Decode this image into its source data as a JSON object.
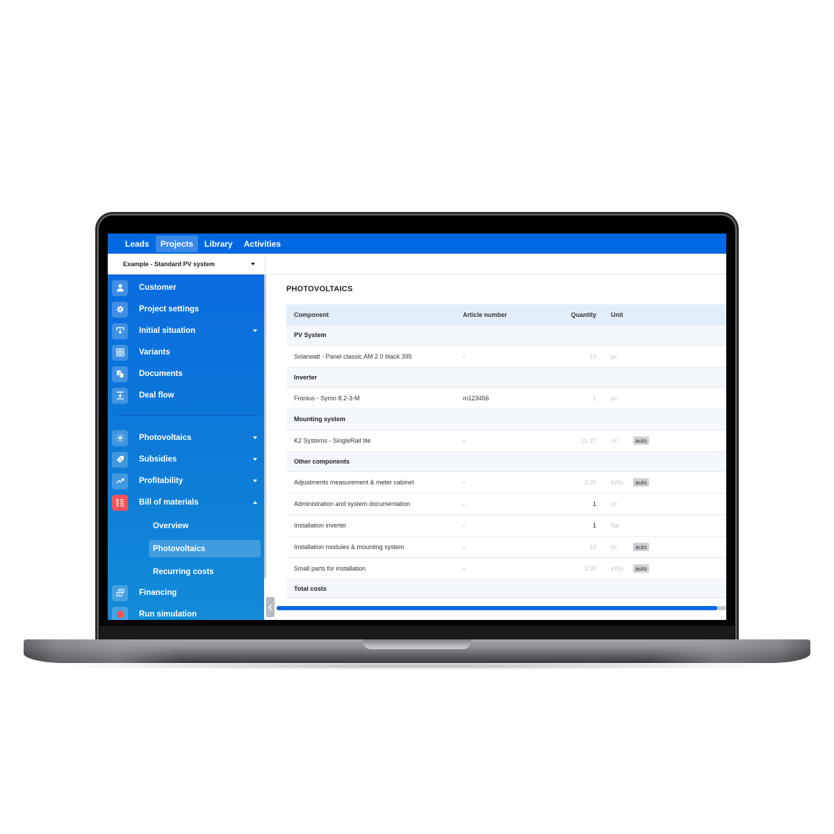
{
  "nav": {
    "tabs": [
      {
        "label": "Leads",
        "active": false
      },
      {
        "label": "Projects",
        "active": true
      },
      {
        "label": "Library",
        "active": false
      },
      {
        "label": "Activities",
        "active": false
      }
    ],
    "brand_color": "#0068e0"
  },
  "project_selector": {
    "value": "Example - Standard PV system"
  },
  "sidebar": {
    "items": [
      {
        "label": "Customer",
        "icon": "user-icon",
        "expandable": false
      },
      {
        "label": "Project settings",
        "icon": "gear-icon",
        "expandable": false
      },
      {
        "label": "Initial situation",
        "icon": "download-tray-icon",
        "expandable": true
      },
      {
        "label": "Variants",
        "icon": "grid-icon",
        "expandable": false
      },
      {
        "label": "Documents",
        "icon": "documents-icon",
        "expandable": false
      },
      {
        "label": "Deal flow",
        "icon": "deal-flow-icon",
        "expandable": false
      },
      {
        "label": "Photovoltaics",
        "icon": "sun-icon",
        "expandable": true
      },
      {
        "label": "Subsidies",
        "icon": "tag-icon",
        "expandable": true
      },
      {
        "label": "Profitability",
        "icon": "trend-up-icon",
        "expandable": true
      },
      {
        "label": "Bill of materials",
        "icon": "list-icon",
        "expandable": true,
        "expanded": true
      },
      {
        "label": "Financing",
        "icon": "money-icon",
        "expandable": false
      },
      {
        "label": "Run simulation",
        "icon": "record-icon",
        "expandable": false
      }
    ],
    "sub_items": [
      {
        "label": "Overview",
        "active": false
      },
      {
        "label": "Photovoltaics",
        "active": true
      },
      {
        "label": "Recurring costs",
        "active": false
      }
    ]
  },
  "main": {
    "title": "PHOTOVOLTAICS",
    "table": {
      "columns": [
        "Component",
        "Article number",
        "Quantity",
        "Unit"
      ],
      "rows": [
        {
          "type": "group",
          "component": "PV System"
        },
        {
          "type": "item",
          "component": "Solarwatt - Panel classic AM 2.0 black 395",
          "article": "-",
          "quantity": "10",
          "unit": "pc",
          "badge": "",
          "qty_style": "muted"
        },
        {
          "type": "group",
          "component": "Inverter"
        },
        {
          "type": "item",
          "component": "Fronius - Symo 8.2-3-M",
          "article": "m123456",
          "quantity": "1",
          "unit": "pc",
          "badge": "",
          "qty_style": "muted"
        },
        {
          "type": "group",
          "component": "Mounting system"
        },
        {
          "type": "item",
          "component": "K2 Systems - SingleRail tile",
          "article": "-",
          "quantity": "19.37",
          "unit": "m²",
          "badge": "auto",
          "qty_style": "muted"
        },
        {
          "type": "group",
          "component": "Other components"
        },
        {
          "type": "item",
          "component": "Adjustments measurement & meter cabinet",
          "article": "-",
          "quantity": "3.95",
          "unit": "kWp",
          "badge": "auto",
          "qty_style": "muted"
        },
        {
          "type": "item",
          "component": "Administration and system documentation",
          "article": "-",
          "quantity": "1",
          "unit": "pc",
          "badge": "",
          "qty_style": "dark"
        },
        {
          "type": "item",
          "component": "Installation inverter",
          "article": "-",
          "quantity": "1",
          "unit": "flat",
          "badge": "",
          "qty_style": "dark"
        },
        {
          "type": "item",
          "component": "Installation modules & mounting system",
          "article": "-",
          "quantity": "10",
          "unit": "pc",
          "badge": "auto",
          "qty_style": "muted"
        },
        {
          "type": "item",
          "component": "Small parts for installation",
          "article": "-",
          "quantity": "3.95",
          "unit": "kWp",
          "badge": "auto",
          "qty_style": "muted"
        },
        {
          "type": "total",
          "component": "Total costs"
        }
      ]
    },
    "horizontal_scroll_fraction": 0.98
  }
}
